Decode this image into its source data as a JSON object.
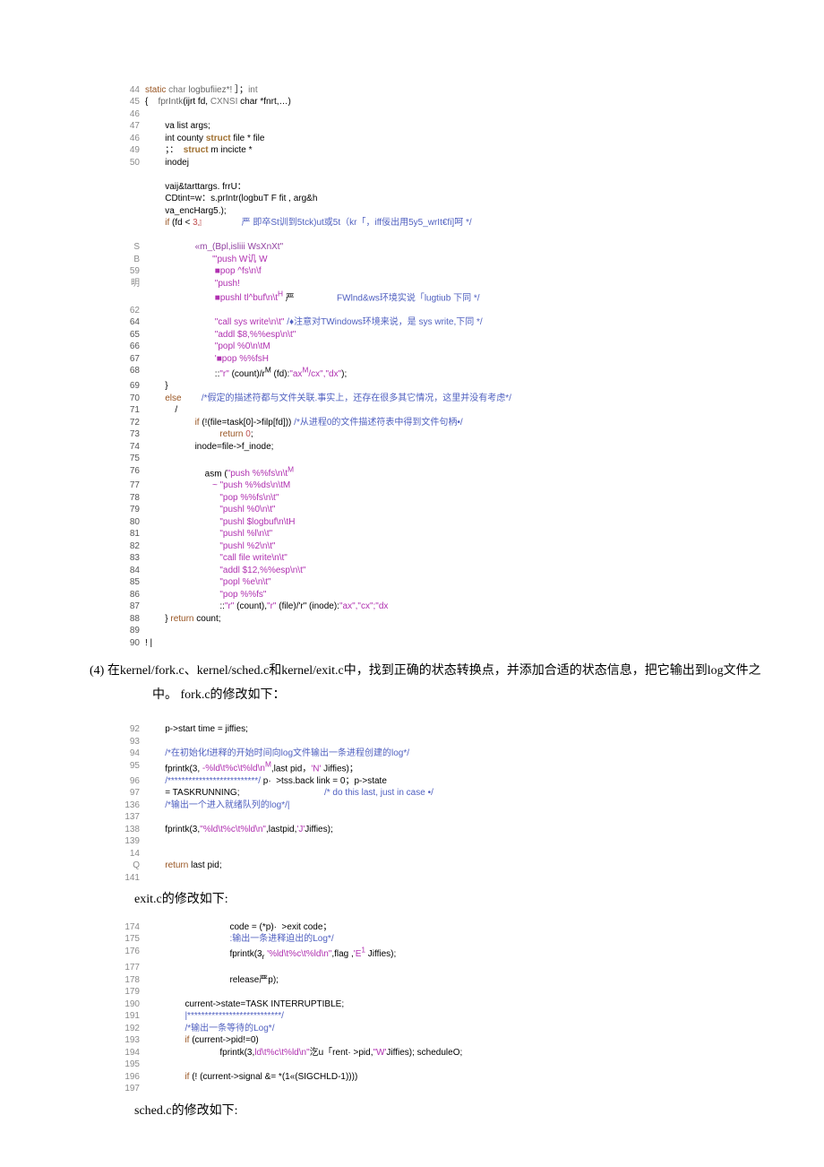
{
  "block1": {
    "l44": {
      "n": "44",
      "t": "static char logbufiiez*! ］；int"
    },
    "l45": {
      "n": "45",
      "t": "{    fprIntk(ijrt fd, CXNSI char *fnrt,…)"
    },
    "l46a": {
      "n": "46",
      "t": ""
    },
    "l47": {
      "n": "47",
      "t": "        va list args;"
    },
    "l46b": {
      "n": "46",
      "t": "        int county struct file * file"
    },
    "l49": {
      "n": "49",
      "t": "        ；：  struct m incicte *"
    },
    "l50": {
      "n": "50",
      "t": "        inodej"
    },
    "lblank1": {
      "n": "",
      "t": ""
    },
    "l_vaij": {
      "n": "",
      "t": "        vaij&tarttargs. frrU："
    },
    "l_cd": {
      "n": "",
      "t": "        CDtint=w：s.prIntr(logbuT F fit , arg&h"
    },
    "l_va": {
      "n": "",
      "t": "        va_encHarg5.);"
    },
    "l_if": {
      "n": "",
      "t": "        if (fd < 3』              严 即卒St训到5tck)ut或5t（kr「，iff佞出用5y5_wrIt€fi]呵 */"
    },
    "lblank2": {
      "n": "",
      "t": ""
    },
    "lS": {
      "n": "S",
      "t": "                    «m_(Bpl,isliii WsXnXt\""
    },
    "lB": {
      "n": "B",
      "t": "                           '\"push W讥 W"
    },
    "l59": {
      "n": "59",
      "t": "                            ■pop ^fs\\n\\f"
    },
    "lHH": {
      "n": "明",
      "t": "                            \"push!"
    },
    "l_pushl": {
      "n": "",
      "t": "                            ■pushl tl^buf\\n\\tH 严                 FWlnd&ws环境实说「lugtiub 下同 */"
    },
    "l62": {
      "n": "62",
      "t": ""
    },
    "l64": {
      "n": "64",
      "t": "                            \"call sys write\\n\\t\" /♦注意对TWindows环境来说，是 sys write,下同 */"
    },
    "l65": {
      "n": "65",
      "t": "                            \"addl $8,%%esp\\n\\t\""
    },
    "l66": {
      "n": "66",
      "t": "                            \"popl %0\\n\\tM"
    },
    "l67": {
      "n": "67",
      "t": "                            '■pop %%fsH"
    },
    "l68": {
      "n": "68",
      "t": "                            ::\"r\" (count)/rM (fd):\"axM/cx\",\"dx\");"
    },
    "l69": {
      "n": "69",
      "t": "        }"
    },
    "l70": {
      "n": "70",
      "t": "        else        /*假定的描述符都与文件关联.事实上，还存在很多其它情况，这里并没有考虑*/"
    },
    "l71": {
      "n": "71",
      "t": "            /"
    },
    "l72": {
      "n": "72",
      "t": "                    if (!(file=task[0]->filp[fd])) /*从进程0的文件描述符表中得到文件句柄•/"
    },
    "l73": {
      "n": "73",
      "t": "                              return 0;"
    },
    "l74": {
      "n": "74",
      "t": "                    inode=file->f_inode;"
    },
    "l75": {
      "n": "75",
      "t": ""
    },
    "l76": {
      "n": "76",
      "t": "                        asm (\"push %%fs\\n\\tM"
    },
    "l77": {
      "n": "77",
      "t": "                           ~ \"push %%ds\\n\\tM"
    },
    "l78": {
      "n": "78",
      "t": "                              \"pop %%fs\\n\\t\""
    },
    "l79": {
      "n": "79",
      "t": "                              \"pushl %0\\n\\t\""
    },
    "l80": {
      "n": "80",
      "t": "                              \"pushl $logbuf\\n\\tH"
    },
    "l81": {
      "n": "81",
      "t": "                              \"pushl %l\\n\\t\""
    },
    "l82": {
      "n": "82",
      "t": "                              \"pushl %2\\n\\t\""
    },
    "l83": {
      "n": "83",
      "t": "                              \"call file write\\n\\t\""
    },
    "l84": {
      "n": "84",
      "t": "                              \"addl $12,%%esp\\n\\t\""
    },
    "l85": {
      "n": "85",
      "t": "                              \"popl %e\\n\\t\""
    },
    "l86": {
      "n": "86",
      "t": "                              \"pop %%fs\""
    },
    "l87": {
      "n": "87",
      "t": "                              ::\"r\" (count),\"r\" (file)/'r\" (inode):\"ax\",\"cx\";\"dx"
    },
    "l88": {
      "n": "88",
      "t": "        } return count;"
    },
    "l89": {
      "n": "89",
      "t": ""
    },
    "l90": {
      "n": "90",
      "t": "! |"
    }
  },
  "para4": "(4)   在kernel/fork.c、kernel/sched.c和kernel/exit.c中，找到正确的状态转换点，并添加合适的状态信息，把它输出到log文件之",
  "para4b": "中。   fork.c的修改如下：",
  "block2": {
    "l92": {
      "n": "92",
      "t": "        p->start time = jiffies;"
    },
    "l93": {
      "n": "93",
      "t": ""
    },
    "l94": {
      "n": "94",
      "t": "        /*在初始化f进释的开始时间向log文件输出一条进程创建的log*/"
    },
    "l95": {
      "n": "95",
      "t": "        fprintk(3, -%ld\\t%c\\t%ld\\nM,last pid，'N' Jiffies)；"
    },
    "l96": {
      "n": "96",
      "t": "        /**************************/ p·  >tss.back link = 0；p->state"
    },
    "l97": {
      "n": "97",
      "t": "        = TASKRUNNING;                                  /* do this last, just in case •/"
    },
    "l136": {
      "n": "136",
      "t": "        /*输出一个进入就绪队列的log*/|"
    },
    "l137": {
      "n": "137",
      "t": ""
    },
    "l138": {
      "n": "138",
      "t": "        fprintk(3,\"%ld\\t%c\\t%ld\\n\",lastpid,'J'Jiffies);"
    },
    "l139": {
      "n": "139",
      "t": ""
    },
    "l14": {
      "n": "14",
      "t": ""
    },
    "lQ": {
      "n": "Q",
      "t": "        return last pid;"
    },
    "l141": {
      "n": "141",
      "t": ""
    }
  },
  "exit_head": "exit.c的修改如下:",
  "block3": {
    "l174": {
      "n": "174",
      "t": "                                  code = (*p)·  >exit code；"
    },
    "l175": {
      "n": "175",
      "t": "                                  :输出一条进释迫出的Log*/"
    },
    "l176": {
      "n": "176",
      "t": "                                  fprintk(3, '%ld\\t%c\\t%ld\\n\",flag ,'E1 Jiffies);"
    },
    "l177": {
      "n": "177",
      "t": ""
    },
    "l178": {
      "n": "178",
      "t": "                                  release严p);"
    },
    "l179": {
      "n": "179",
      "t": ""
    },
    "l190": {
      "n": "190",
      "t": "                current->state=TASK INTERRUPTIBLE;"
    },
    "l191": {
      "n": "191",
      "t": "                |***************************/"
    },
    "l192": {
      "n": "192",
      "t": "                /*输出一条等待的Log*/"
    },
    "l193": {
      "n": "193",
      "t": "                if (current->pid!=0)"
    },
    "l194": {
      "n": "194",
      "t": "                              fprintk(3,ld\\t%c\\t%ld\\n\"汔u「rent· >pid,\"W'Jiffies); scheduleO;"
    },
    "l195": {
      "n": "195",
      "t": ""
    },
    "l196": {
      "n": "196",
      "t": "                if (! (current->signal &= *(1«(SIGCHLD-1))))"
    },
    "l197": {
      "n": "197",
      "t": ""
    }
  },
  "sched_head": "sched.c的修改如下:"
}
